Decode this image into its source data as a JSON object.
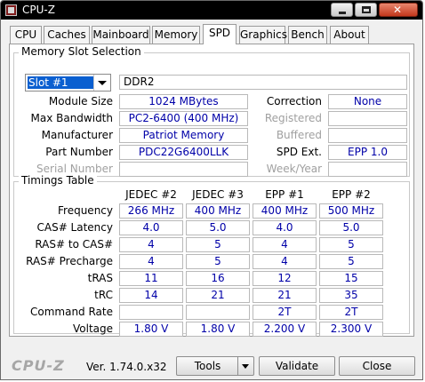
{
  "window": {
    "title": "CPU-Z"
  },
  "tabs": [
    "CPU",
    "Caches",
    "Mainboard",
    "Memory",
    "SPD",
    "Graphics",
    "Bench",
    "About"
  ],
  "active_tab": "SPD",
  "slot": {
    "group_title": "Memory Slot Selection",
    "selected": "Slot #1",
    "memory_type": "DDR2",
    "labels": {
      "module_size": "Module Size",
      "max_bandwidth": "Max Bandwidth",
      "manufacturer": "Manufacturer",
      "part_number": "Part Number",
      "serial_number": "Serial Number",
      "correction": "Correction",
      "registered": "Registered",
      "buffered": "Buffered",
      "spd_ext": "SPD Ext.",
      "week_year": "Week/Year"
    },
    "values": {
      "module_size": "1024 MBytes",
      "max_bandwidth": "PC2-6400 (400 MHz)",
      "manufacturer": "Patriot Memory",
      "part_number": "PDC22G6400LLK",
      "serial_number": "",
      "correction": "None",
      "registered": "",
      "buffered": "",
      "spd_ext": "EPP 1.0",
      "week_year": ""
    }
  },
  "timings": {
    "group_title": "Timings Table",
    "columns": [
      "JEDEC #2",
      "JEDEC #3",
      "EPP #1",
      "EPP #2"
    ],
    "rows": [
      {
        "label": "Frequency",
        "values": [
          "266 MHz",
          "400 MHz",
          "400 MHz",
          "500 MHz"
        ]
      },
      {
        "label": "CAS# Latency",
        "values": [
          "4.0",
          "5.0",
          "4.0",
          "5.0"
        ]
      },
      {
        "label": "RAS# to CAS#",
        "values": [
          "4",
          "5",
          "4",
          "5"
        ]
      },
      {
        "label": "RAS# Precharge",
        "values": [
          "4",
          "5",
          "4",
          "5"
        ]
      },
      {
        "label": "tRAS",
        "values": [
          "11",
          "16",
          "12",
          "15"
        ]
      },
      {
        "label": "tRC",
        "values": [
          "14",
          "21",
          "21",
          "35"
        ]
      },
      {
        "label": "Command Rate",
        "values": [
          "",
          "",
          "2T",
          "2T"
        ]
      },
      {
        "label": "Voltage",
        "values": [
          "1.80 V",
          "1.80 V",
          "2.200 V",
          "2.300 V"
        ]
      }
    ]
  },
  "footer": {
    "brand": "CPU-Z",
    "version": "Ver. 1.74.0.x32",
    "tools_label": "Tools",
    "validate_label": "Validate",
    "close_label": "Close"
  }
}
